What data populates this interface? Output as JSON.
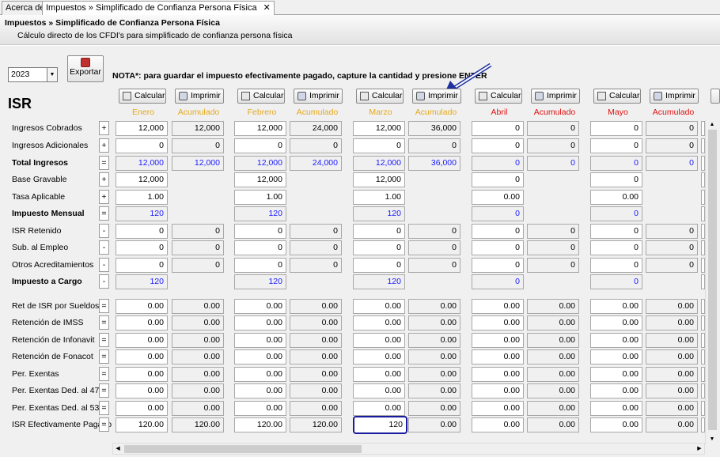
{
  "tabs": [
    {
      "label": "Acerca de"
    },
    {
      "label": "Impuestos » Simplificado de Confianza Persona Física",
      "close": "✕"
    }
  ],
  "header": {
    "title": "Impuestos » Simplificado de Confianza Persona Física",
    "subtitle": "Cálculo directo de los CFDI's para simplificado de confianza persona física"
  },
  "toolbar": {
    "year": "2023",
    "export_label": "Exportar",
    "note": "NOTA*: para guardar el impuesto efectivamente pagado, capture la cantidad y presione ENTER"
  },
  "section_title": "ISR",
  "buttons": {
    "calcular": "Calcular",
    "imprimir": "Imprimir"
  },
  "months": [
    {
      "name": "Enero",
      "acum": "Acumulado",
      "color": "#e5a91d"
    },
    {
      "name": "Febrero",
      "acum": "Acumulado",
      "color": "#e5a91d"
    },
    {
      "name": "Marzo",
      "acum": "Acumulado",
      "color": "#e5a91d"
    },
    {
      "name": "Abril",
      "acum": "Acumulado",
      "color": "#e01010"
    },
    {
      "name": "Mayo",
      "acum": "Acumulado",
      "color": "#e01010"
    }
  ],
  "rows": [
    {
      "label": "Ingresos Cobrados",
      "op": "+",
      "bold": false,
      "blue": false,
      "vals": [
        "12,000",
        "12,000",
        "12,000",
        "24,000",
        "12,000",
        "36,000",
        "0",
        "0",
        "0",
        "0"
      ]
    },
    {
      "label": "Ingresos Adicionales",
      "op": "+",
      "bold": false,
      "blue": false,
      "vals": [
        "0",
        "0",
        "0",
        "0",
        "0",
        "0",
        "0",
        "0",
        "0",
        "0"
      ]
    },
    {
      "label": "Total Ingresos",
      "op": "=",
      "bold": true,
      "blue": true,
      "vals": [
        "12,000",
        "12,000",
        "12,000",
        "24,000",
        "12,000",
        "36,000",
        "0",
        "0",
        "0",
        "0"
      ]
    },
    {
      "label": "Base Gravable",
      "op": "+",
      "bold": false,
      "blue": false,
      "vals": [
        "12,000",
        "",
        "12,000",
        "",
        "12,000",
        "",
        "0",
        "",
        "0",
        ""
      ]
    },
    {
      "label": "Tasa Aplicable",
      "op": "+",
      "bold": false,
      "blue": false,
      "vals": [
        "1.00",
        "",
        "1.00",
        "",
        "1.00",
        "",
        "0.00",
        "",
        "0.00",
        ""
      ]
    },
    {
      "label": "Impuesto Mensual",
      "op": "=",
      "bold": true,
      "blue": true,
      "vals": [
        "120",
        "",
        "120",
        "",
        "120",
        "",
        "0",
        "",
        "0",
        ""
      ]
    },
    {
      "label": "ISR Retenido",
      "op": "-",
      "bold": false,
      "blue": false,
      "vals": [
        "0",
        "0",
        "0",
        "0",
        "0",
        "0",
        "0",
        "0",
        "0",
        "0"
      ]
    },
    {
      "label": "Sub. al Empleo",
      "op": "-",
      "bold": false,
      "blue": false,
      "vals": [
        "0",
        "0",
        "0",
        "0",
        "0",
        "0",
        "0",
        "0",
        "0",
        "0"
      ]
    },
    {
      "label": "Otros Acreditamientos",
      "op": "-",
      "bold": false,
      "blue": false,
      "vals": [
        "0",
        "0",
        "0",
        "0",
        "0",
        "0",
        "0",
        "0",
        "0",
        "0"
      ]
    },
    {
      "label": "Impuesto a Cargo",
      "op": "-",
      "bold": true,
      "blue": true,
      "vals": [
        "120",
        "",
        "120",
        "",
        "120",
        "",
        "0",
        "",
        "0",
        ""
      ]
    },
    {
      "label": "Ret de ISR por Sueldos",
      "op": "=",
      "bold": false,
      "blue": false,
      "vals": [
        "0.00",
        "0.00",
        "0.00",
        "0.00",
        "0.00",
        "0.00",
        "0.00",
        "0.00",
        "0.00",
        "0.00"
      ]
    },
    {
      "label": "Retención de IMSS",
      "op": "=",
      "bold": false,
      "blue": false,
      "vals": [
        "0.00",
        "0.00",
        "0.00",
        "0.00",
        "0.00",
        "0.00",
        "0.00",
        "0.00",
        "0.00",
        "0.00"
      ]
    },
    {
      "label": "Retención de Infonavit",
      "op": "=",
      "bold": false,
      "blue": false,
      "vals": [
        "0.00",
        "0.00",
        "0.00",
        "0.00",
        "0.00",
        "0.00",
        "0.00",
        "0.00",
        "0.00",
        "0.00"
      ]
    },
    {
      "label": "Retención de Fonacot",
      "op": "=",
      "bold": false,
      "blue": false,
      "vals": [
        "0.00",
        "0.00",
        "0.00",
        "0.00",
        "0.00",
        "0.00",
        "0.00",
        "0.00",
        "0.00",
        "0.00"
      ]
    },
    {
      "label": "Per. Exentas",
      "op": "=",
      "bold": false,
      "blue": false,
      "vals": [
        "0.00",
        "0.00",
        "0.00",
        "0.00",
        "0.00",
        "0.00",
        "0.00",
        "0.00",
        "0.00",
        "0.00"
      ]
    },
    {
      "label": "Per. Exentas Ded. al 47%",
      "op": "=",
      "bold": false,
      "blue": false,
      "vals": [
        "0.00",
        "0.00",
        "0.00",
        "0.00",
        "0.00",
        "0.00",
        "0.00",
        "0.00",
        "0.00",
        "0.00"
      ]
    },
    {
      "label": "Per. Exentas Ded. al 53%",
      "op": "=",
      "bold": false,
      "blue": false,
      "vals": [
        "0.00",
        "0.00",
        "0.00",
        "0.00",
        "0.00",
        "0.00",
        "0.00",
        "0.00",
        "0.00",
        "0.00"
      ]
    },
    {
      "label": "ISR Efectivamente Pagado",
      "op": "=",
      "bold": false,
      "blue": false,
      "vals": [
        "120.00",
        "120.00",
        "120.00",
        "120.00",
        "120",
        "0.00",
        "0.00",
        "0.00",
        "0.00",
        "0.00"
      ]
    }
  ]
}
